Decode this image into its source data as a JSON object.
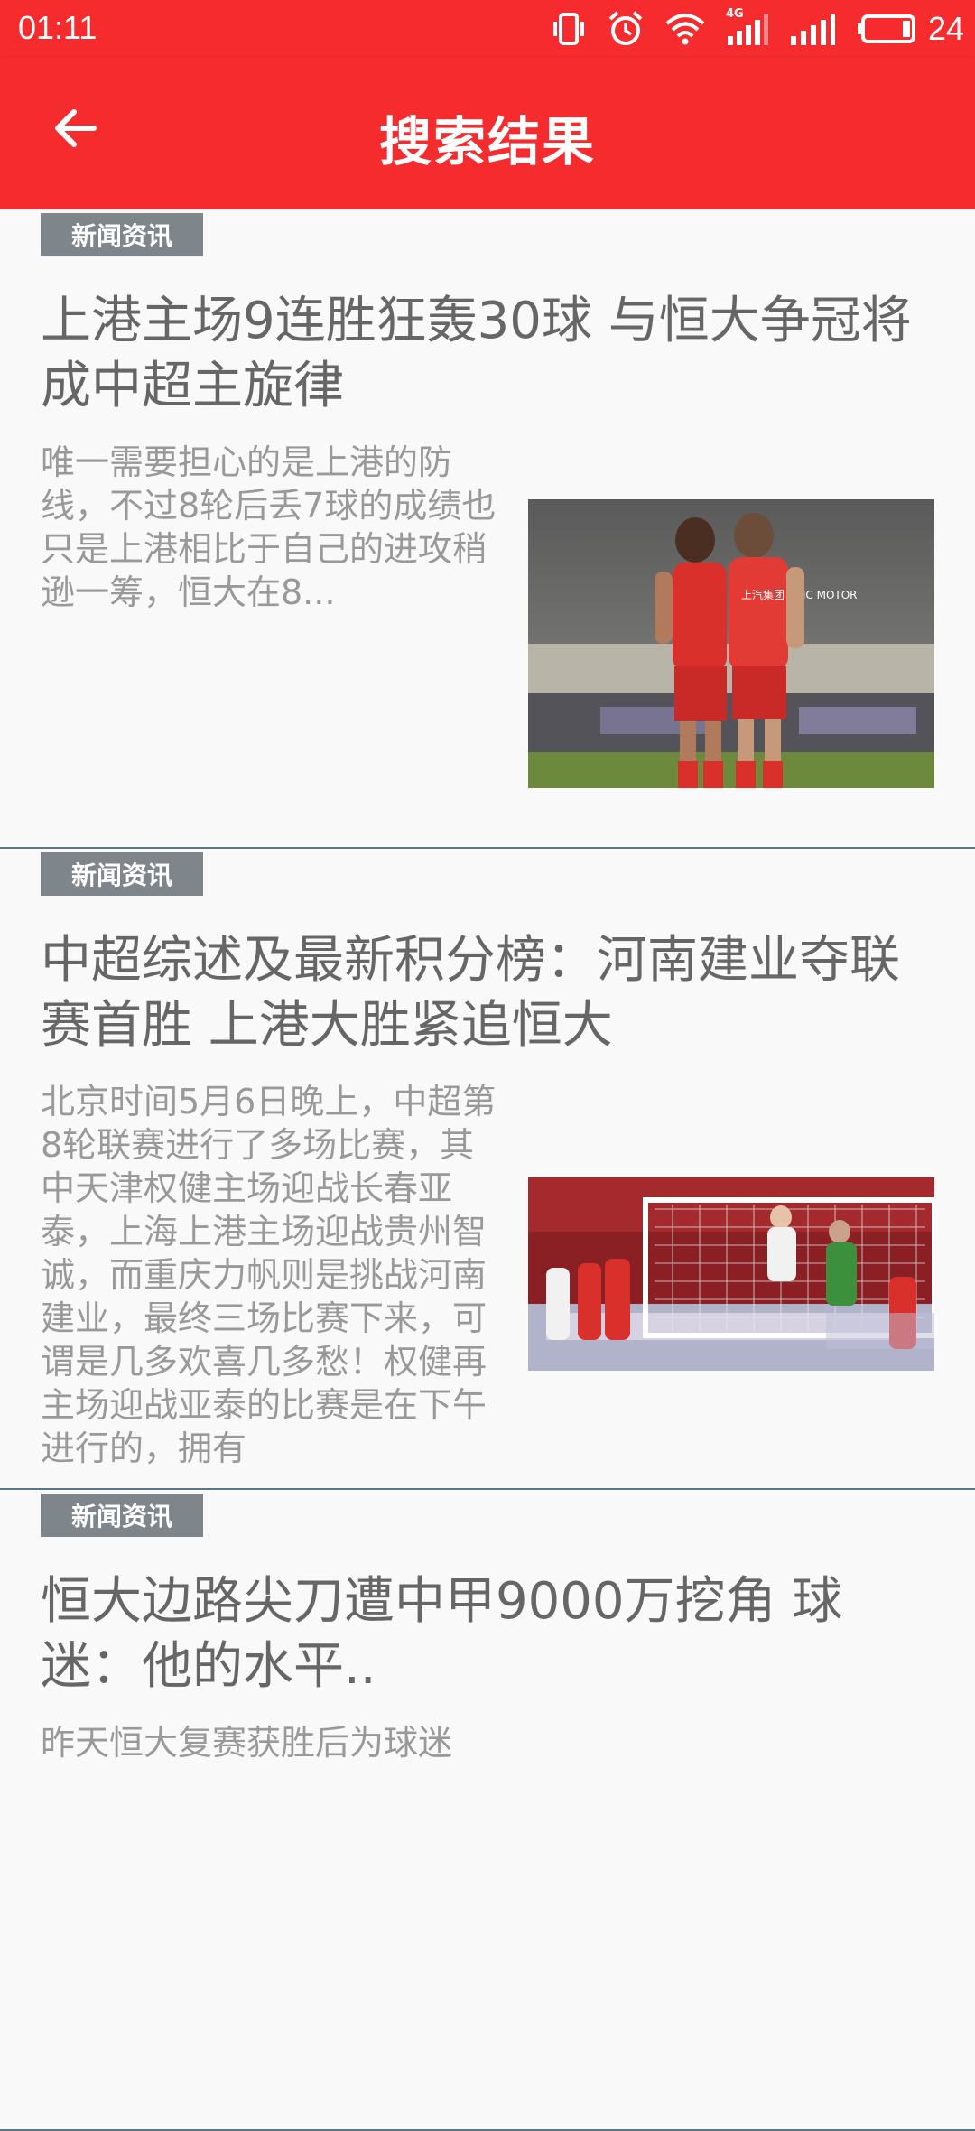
{
  "status_bar": {
    "time": "01:11",
    "network_label": "4G",
    "battery_level": "24",
    "icons": [
      "vibrate-icon",
      "alarm-icon",
      "wifi-icon",
      "signal-4g-icon",
      "signal-icon",
      "battery-icon"
    ]
  },
  "app_bar": {
    "title": "搜索结果",
    "back_icon": "arrow-back-icon"
  },
  "colors": {
    "primary": "#f52b2e",
    "tag_bg": "#7e868c",
    "divider": "#5b7589",
    "title_text": "#666666",
    "summary_text": "#999999"
  },
  "results": [
    {
      "tag": "新闻资讯",
      "title": "上港主场9连胜狂轰30球 与恒大争冠将成中超主旋律",
      "summary": "唯一需要担心的是上港的防线，不过8轮后丢7球的成绩也只是上港相比于自己的进攻稍逊一筹，恒大在8...",
      "image": "two-soccer-players-red-kits-photo",
      "jersey_text": "上汽集团 SAIC MOTOR"
    },
    {
      "tag": "新闻资讯",
      "title": "中超综述及最新积分榜：河南建业夺联赛首胜 上港大胜紧追恒大",
      "summary": "北京时间5月6日晚上，中超第8轮联赛进行了多场比赛，其中天津权健主场迎战长春亚泰，上海上港主场迎战贵州智诚，而重庆力帆则是挑战河南建业，最终三场比赛下来，可谓是几多欢喜几多愁！权健再主场迎战亚泰的比赛是在下午进行的，拥有",
      "image": "goalkeeper-save-match-photo"
    },
    {
      "tag": "新闻资讯",
      "title": "恒大边路尖刀遭中甲9000万挖角 球迷：他的水平..",
      "summary": "昨天恒大复赛获胜后为球迷",
      "image": ""
    }
  ]
}
